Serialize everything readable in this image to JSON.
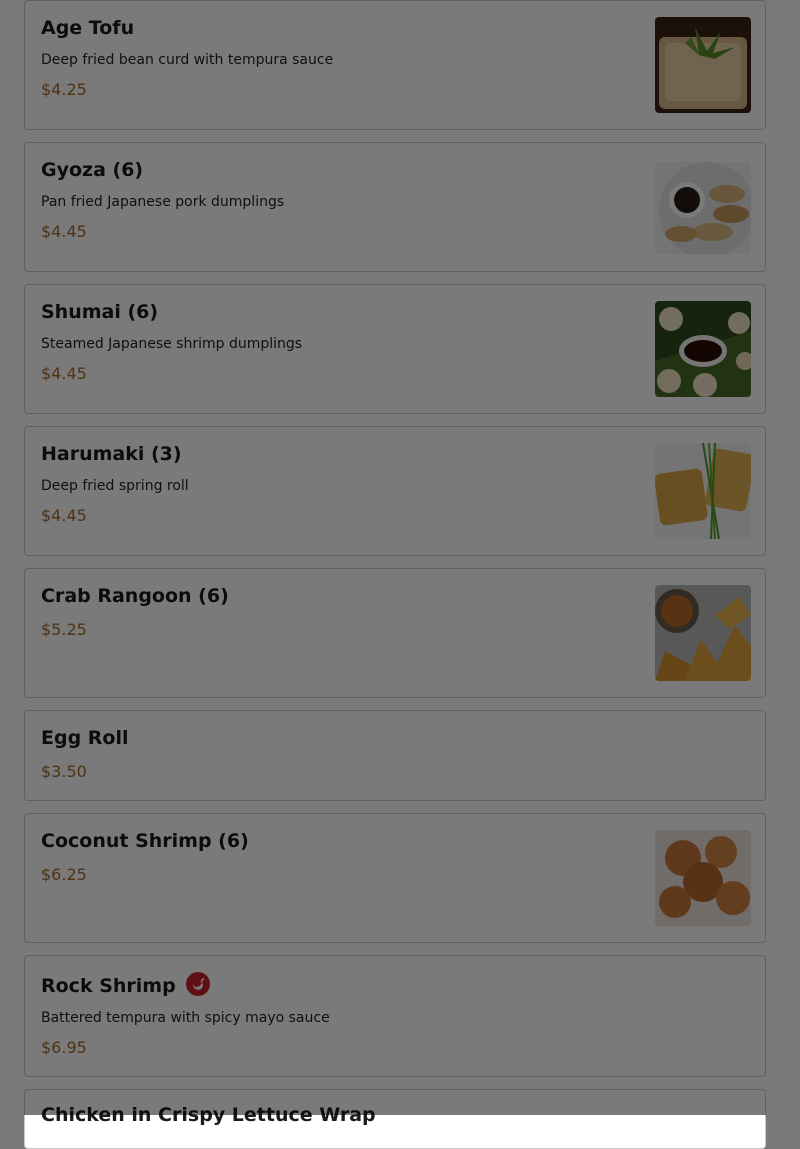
{
  "menu_items": [
    {
      "name": "Age Tofu",
      "description": "Deep fried bean curd with tempura sauce",
      "price": "$4.25"
    },
    {
      "name": "Gyoza (6)",
      "description": "Pan fried Japanese pork dumplings",
      "price": "$4.45"
    },
    {
      "name": "Shumai (6)",
      "description": "Steamed Japanese shrimp dumplings",
      "price": "$4.45"
    },
    {
      "name": "Harumaki (3)",
      "description": "Deep fried spring roll",
      "price": "$4.45"
    },
    {
      "name": "Crab Rangoon (6)",
      "price": "$5.25"
    },
    {
      "name": "Egg Roll",
      "price": "$3.50"
    },
    {
      "name": "Coconut Shrimp (6)",
      "price": "$6.25"
    },
    {
      "name": "Rock Shrimp",
      "description": "Battered tempura with spicy mayo sauce",
      "price": "$6.95",
      "spicy_icon": "chili-pepper-icon"
    },
    {
      "name": "Chicken in Crispy Lettuce Wrap"
    }
  ],
  "colors": {
    "price": "#a86a2a",
    "spicy_badge": "#c8202a",
    "card_border": "#c9c9c9",
    "dim_overlay": "rgba(0,0,0,0.52)"
  }
}
